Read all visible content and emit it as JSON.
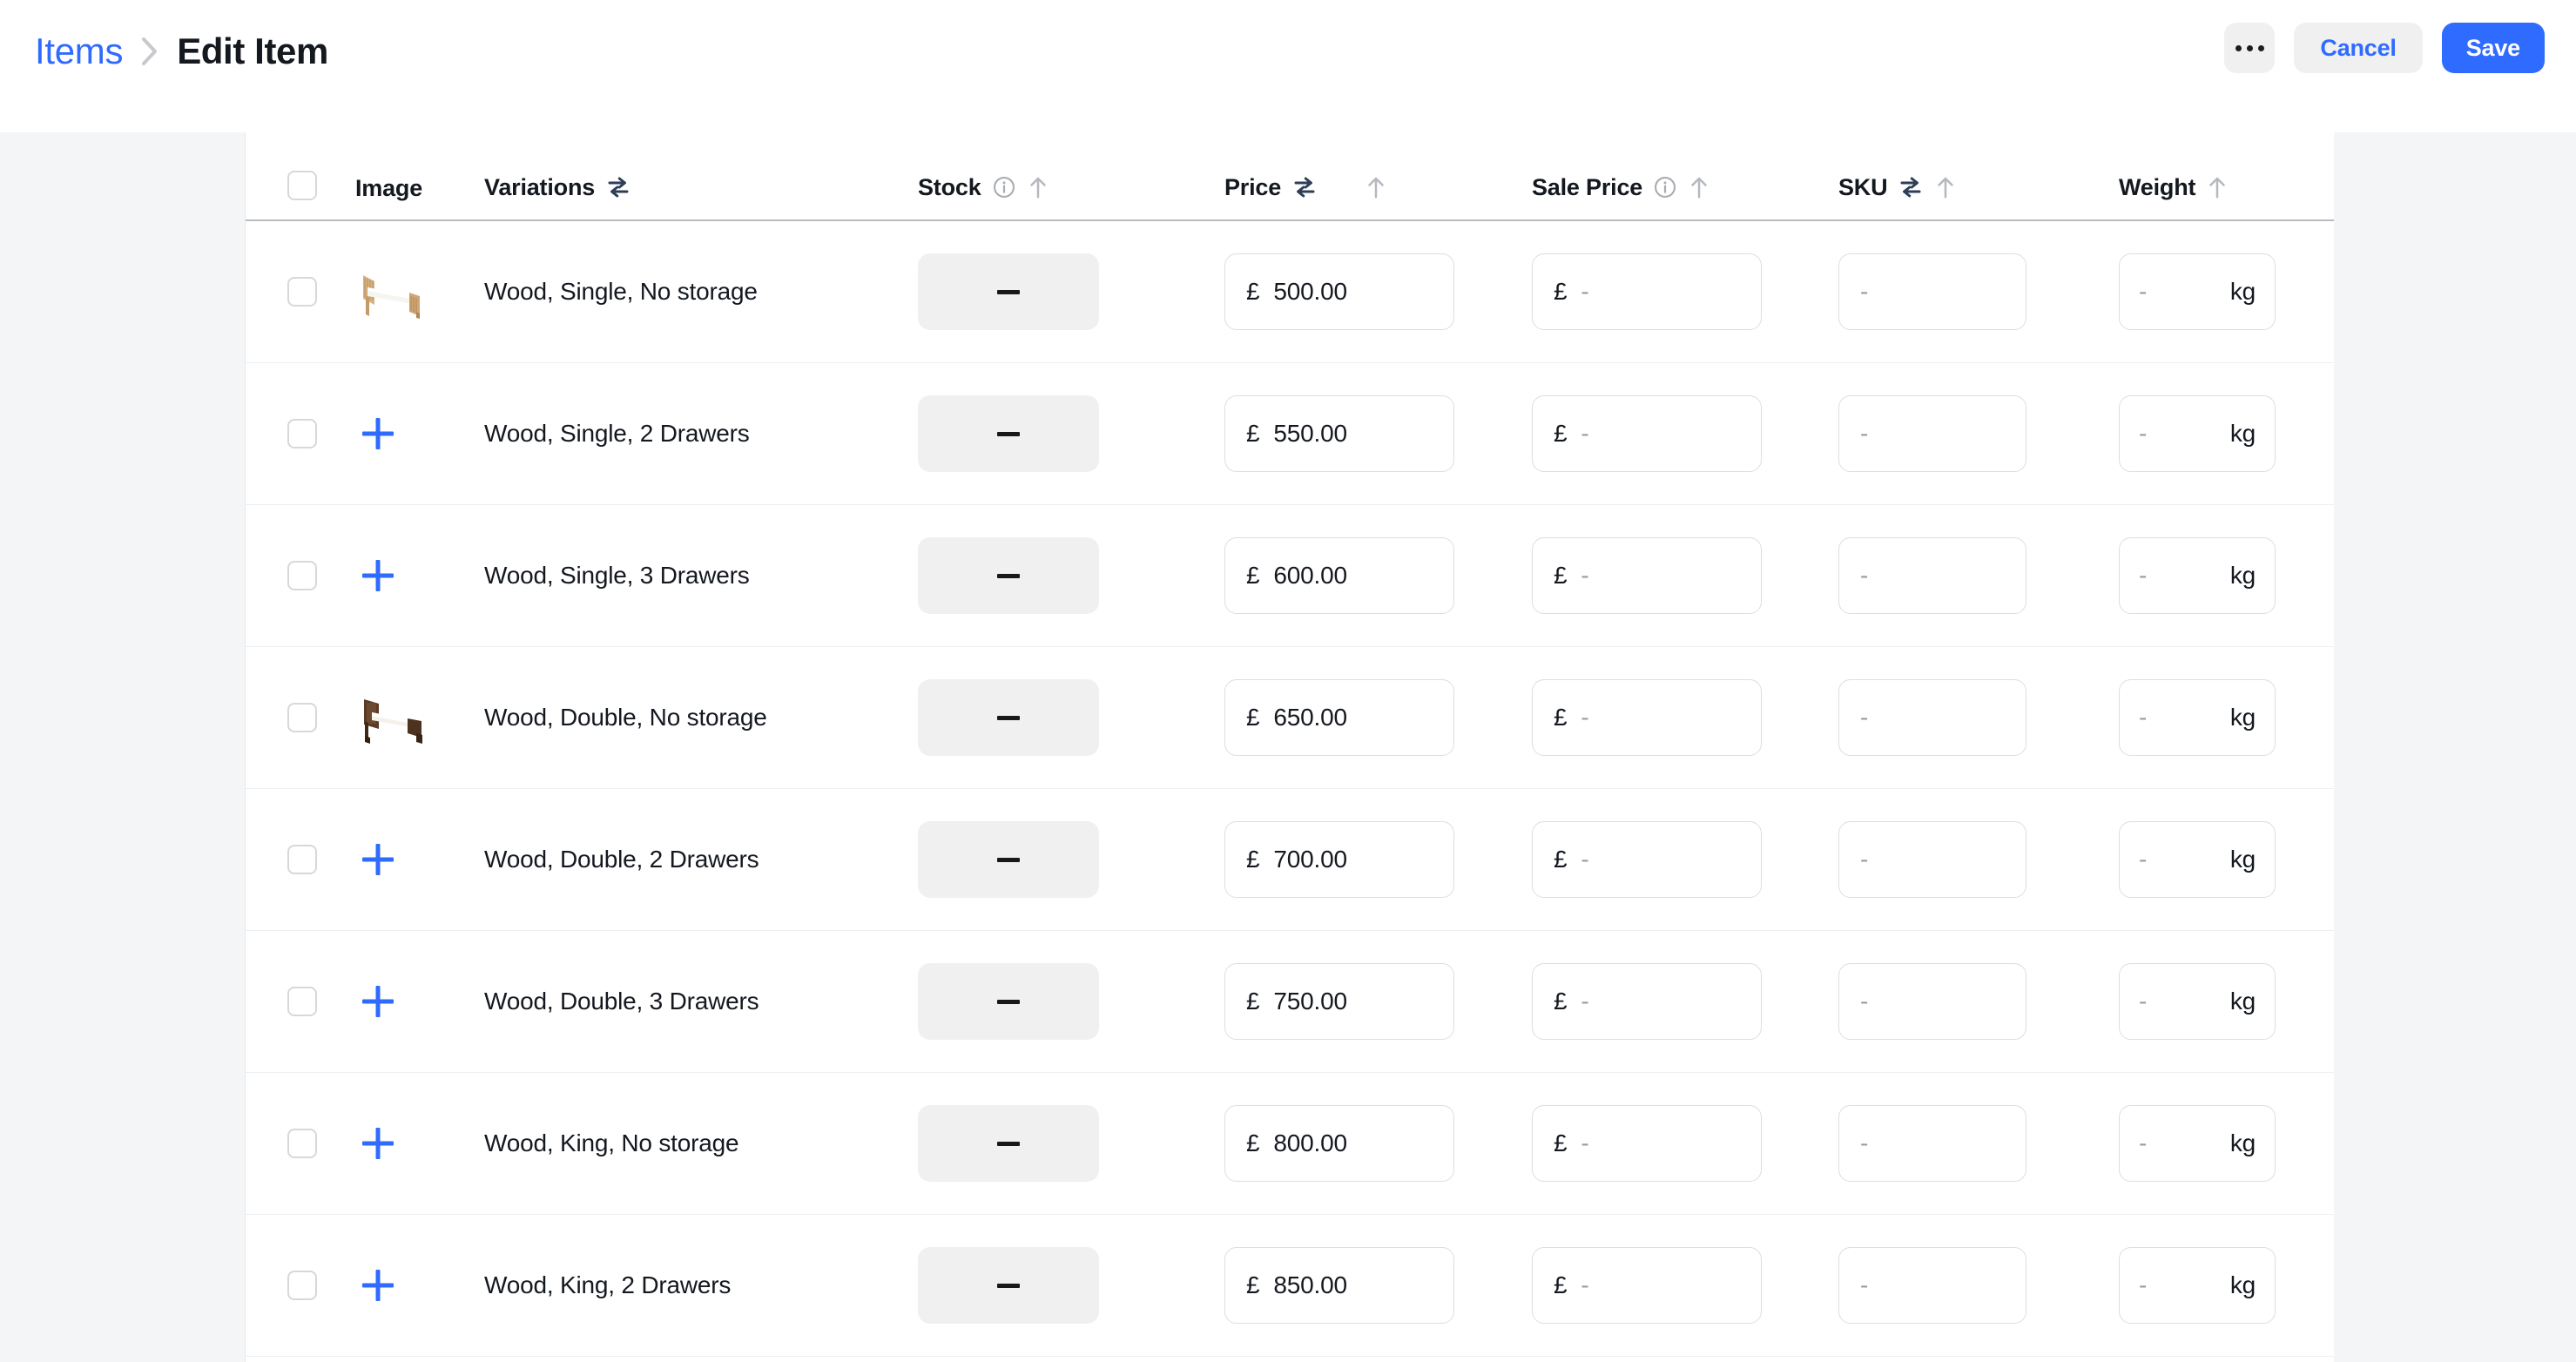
{
  "header": {
    "breadcrumb_parent": "Items",
    "breadcrumb_sep": "›",
    "breadcrumb_current": "Edit Item",
    "more_label": "",
    "cancel_label": "Cancel",
    "save_label": "Save",
    "accent_blue": "#2f6bff",
    "button_gray": "#f0f0f0"
  },
  "table": {
    "columns": [
      {
        "key": "select",
        "label": "",
        "icons": []
      },
      {
        "key": "image",
        "label": "Image",
        "icons": []
      },
      {
        "key": "variations",
        "label": "Variations",
        "icons": [
          "swap-icon"
        ]
      },
      {
        "key": "stock",
        "label": "Stock",
        "icons": [
          "info-icon",
          "sort-arrow-up-icon"
        ]
      },
      {
        "key": "price",
        "label": "Price",
        "icons": [
          "swap-icon",
          "sort-arrow-up-icon"
        ]
      },
      {
        "key": "sale_price",
        "label": "Sale Price",
        "icons": [
          "info-icon",
          "sort-arrow-up-icon"
        ]
      },
      {
        "key": "sku",
        "label": "SKU",
        "icons": [
          "swap-icon",
          "sort-arrow-up-icon"
        ]
      },
      {
        "key": "weight",
        "label": "Weight",
        "icons": [
          "sort-arrow-up-icon"
        ]
      }
    ],
    "currency_symbol": "£",
    "weight_unit": "kg",
    "stock_value": "—",
    "empty_placeholder": "-",
    "add_image_icon": "plus-icon",
    "rows": [
      {
        "selected": false,
        "image": "bed-light-wood",
        "variation": "Wood, Single, No storage",
        "stock": "—",
        "price": "500.00",
        "sale_price": "-",
        "sku": "-",
        "weight": "-"
      },
      {
        "selected": false,
        "image": "add",
        "variation": "Wood, Single, 2 Drawers",
        "stock": "—",
        "price": "550.00",
        "sale_price": "-",
        "sku": "-",
        "weight": "-"
      },
      {
        "selected": false,
        "image": "add",
        "variation": "Wood, Single, 3 Drawers",
        "stock": "—",
        "price": "600.00",
        "sale_price": "-",
        "sku": "-",
        "weight": "-"
      },
      {
        "selected": false,
        "image": "bed-dark-wood",
        "variation": "Wood, Double, No storage",
        "stock": "—",
        "price": "650.00",
        "sale_price": "-",
        "sku": "-",
        "weight": "-"
      },
      {
        "selected": false,
        "image": "add",
        "variation": "Wood, Double, 2 Drawers",
        "stock": "—",
        "price": "700.00",
        "sale_price": "-",
        "sku": "-",
        "weight": "-"
      },
      {
        "selected": false,
        "image": "add",
        "variation": "Wood, Double, 3 Drawers",
        "stock": "—",
        "price": "750.00",
        "sale_price": "-",
        "sku": "-",
        "weight": "-"
      },
      {
        "selected": false,
        "image": "add",
        "variation": "Wood, King, No storage",
        "stock": "—",
        "price": "800.00",
        "sale_price": "-",
        "sku": "-",
        "weight": "-"
      },
      {
        "selected": false,
        "image": "add",
        "variation": "Wood, King, 2 Drawers",
        "stock": "—",
        "price": "850.00",
        "sale_price": "-",
        "sku": "-",
        "weight": "-"
      }
    ]
  }
}
